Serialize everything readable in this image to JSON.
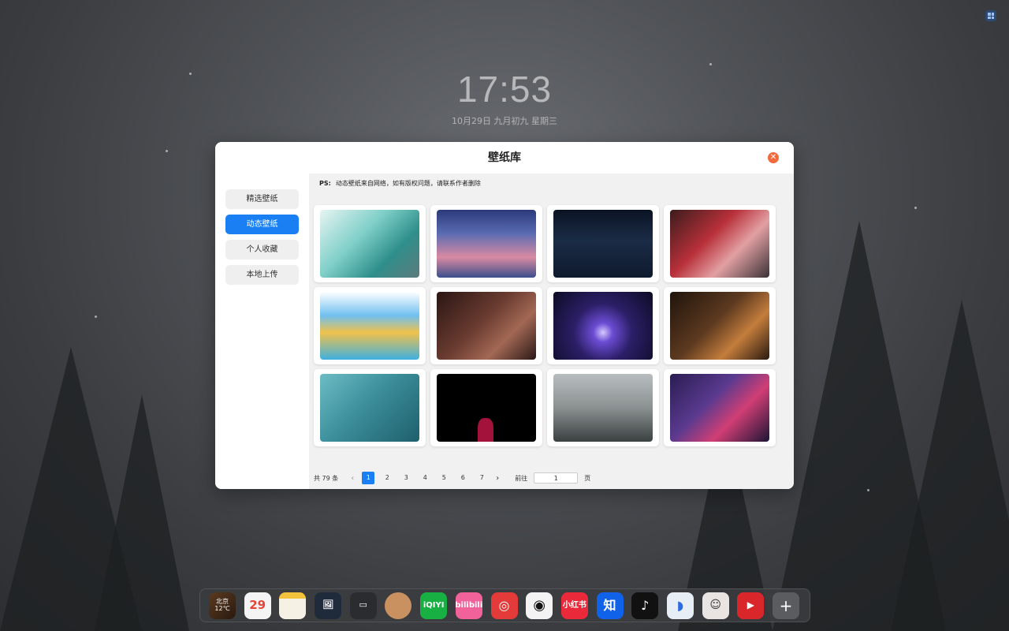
{
  "desktop": {
    "time": "17:53",
    "date": "10月29日 九月初九 星期三"
  },
  "dialog": {
    "title": "壁纸库",
    "close_icon": "close-icon",
    "sidebar": {
      "items": [
        {
          "label": "精选壁纸",
          "active": false
        },
        {
          "label": "动态壁纸",
          "active": true
        },
        {
          "label": "个人收藏",
          "active": false
        },
        {
          "label": "本地上传",
          "active": false
        }
      ]
    },
    "notice": {
      "prefix": "PS:",
      "text": "动态壁纸来自网络，如有版权问题，请联系作者删除"
    },
    "wallpapers": [
      {
        "name": "anime-girl-teal"
      },
      {
        "name": "comet-sky"
      },
      {
        "name": "neon-dark-room"
      },
      {
        "name": "red-tree-sunset"
      },
      {
        "name": "colorful-anime-girl"
      },
      {
        "name": "warm-interior"
      },
      {
        "name": "purple-moon-forest"
      },
      {
        "name": "cozy-room-night"
      },
      {
        "name": "spider-hero-jump"
      },
      {
        "name": "black-red-figure"
      },
      {
        "name": "snowy-forest"
      },
      {
        "name": "neon-city-pixel"
      }
    ],
    "pagination": {
      "total": "共 79 条",
      "pages": [
        "1",
        "2",
        "3",
        "4",
        "5",
        "6",
        "7"
      ],
      "current": "1",
      "goto_label": "前往",
      "goto_value": "1",
      "unit": "页"
    }
  },
  "dock": {
    "items": [
      {
        "name": "weather",
        "line1": "北京",
        "line2": "12℃"
      },
      {
        "name": "calendar",
        "label": "29"
      },
      {
        "name": "notes",
        "label": ""
      },
      {
        "name": "photos",
        "label": "🖼"
      },
      {
        "name": "files",
        "label": "▭"
      },
      {
        "name": "avatar",
        "label": ""
      },
      {
        "name": "iqiyi",
        "label": "iQIYI"
      },
      {
        "name": "bilibili",
        "label": "bilibili"
      },
      {
        "name": "netease-music",
        "label": "◎"
      },
      {
        "name": "github",
        "label": "◉"
      },
      {
        "name": "xiaohongshu",
        "label": "小红书"
      },
      {
        "name": "zhihu",
        "label": "知"
      },
      {
        "name": "tiktok",
        "label": "♪"
      },
      {
        "name": "fish-app",
        "label": "◗"
      },
      {
        "name": "avatar-girl",
        "label": "☺"
      },
      {
        "name": "youtube",
        "label": "▶"
      },
      {
        "name": "add",
        "label": "+"
      }
    ]
  },
  "colors": {
    "accent": "#1a7ff2",
    "close": "#f26a3d"
  }
}
